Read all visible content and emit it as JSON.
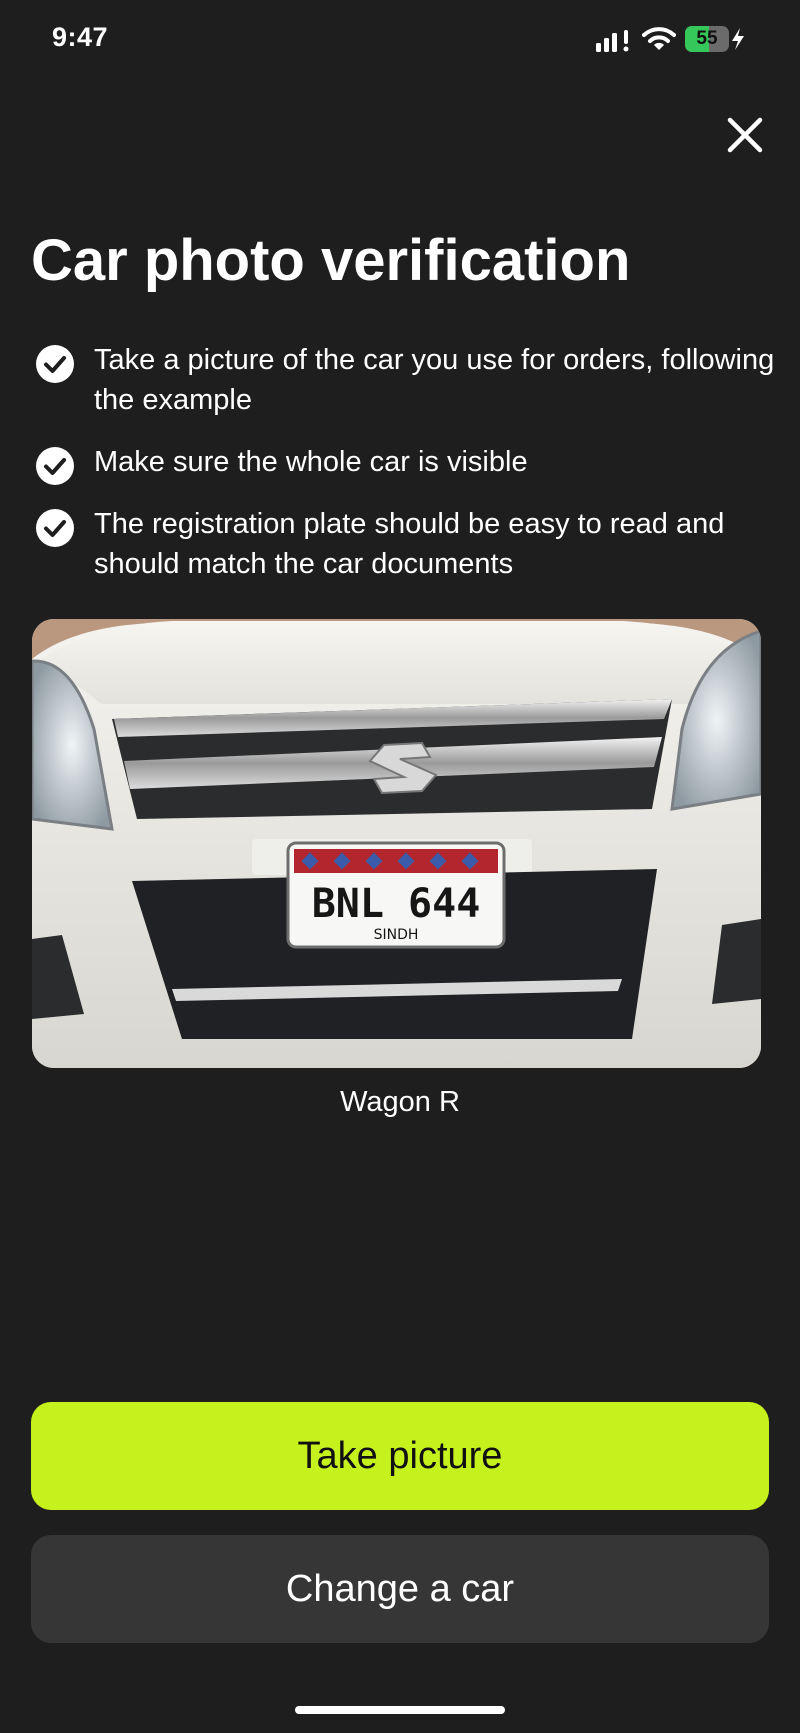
{
  "status_bar": {
    "time": "9:47",
    "battery_level": "55",
    "battery_fraction": 0.55,
    "icons": [
      "signal-icon",
      "wifi-icon",
      "battery-icon",
      "charging-bolt-icon"
    ]
  },
  "header": {
    "close_icon": "close-icon",
    "title": "Car photo verification"
  },
  "checklist": [
    {
      "icon": "check-circle-icon",
      "text": "Take a picture of the car you use for orders, following the example"
    },
    {
      "icon": "check-circle-icon",
      "text": "Make sure the whole car is visible"
    },
    {
      "icon": "check-circle-icon",
      "text": "The registration plate should be easy to read and should match the car documents"
    }
  ],
  "example_photo": {
    "plate_number": "BNL 644",
    "plate_region": "SINDH",
    "caption": "Wagon R"
  },
  "actions": {
    "primary_label": "Take picture",
    "secondary_label": "Change a car"
  },
  "colors": {
    "background": "#1e1e1e",
    "accent": "#c5f21d",
    "secondary_button": "#363636",
    "battery_green": "#35c759"
  }
}
